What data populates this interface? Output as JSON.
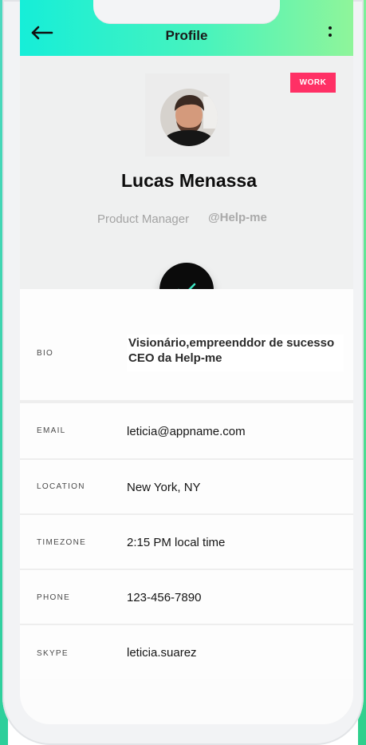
{
  "header": {
    "title": "Profile",
    "back_icon": "arrow-left-icon",
    "more_icon": "more-vertical-icon"
  },
  "profile": {
    "badge": "WORK",
    "name": "Lucas Menassa",
    "role": "Product Manager",
    "handle": "@Help-me",
    "check_icon": "check-icon"
  },
  "details": {
    "bio": {
      "label": "BIO",
      "value": "Visionário,empreenddor de sucesso CEO da Help-me"
    },
    "email": {
      "label": "EMAIL",
      "value": "leticia@appname.com"
    },
    "location": {
      "label": "LOCATION",
      "value": "New York, NY"
    },
    "timezone": {
      "label": "TIMEZONE",
      "value": "2:15 PM local time"
    },
    "phone": {
      "label": "PHONE",
      "value": "123-456-7890"
    },
    "skype": {
      "label": "SKYPE",
      "value": "leticia.suarez"
    }
  },
  "colors": {
    "header_start": "#16eed8",
    "header_end": "#8ff59a",
    "badge": "#ff3065",
    "check": "#3ee6c4"
  }
}
